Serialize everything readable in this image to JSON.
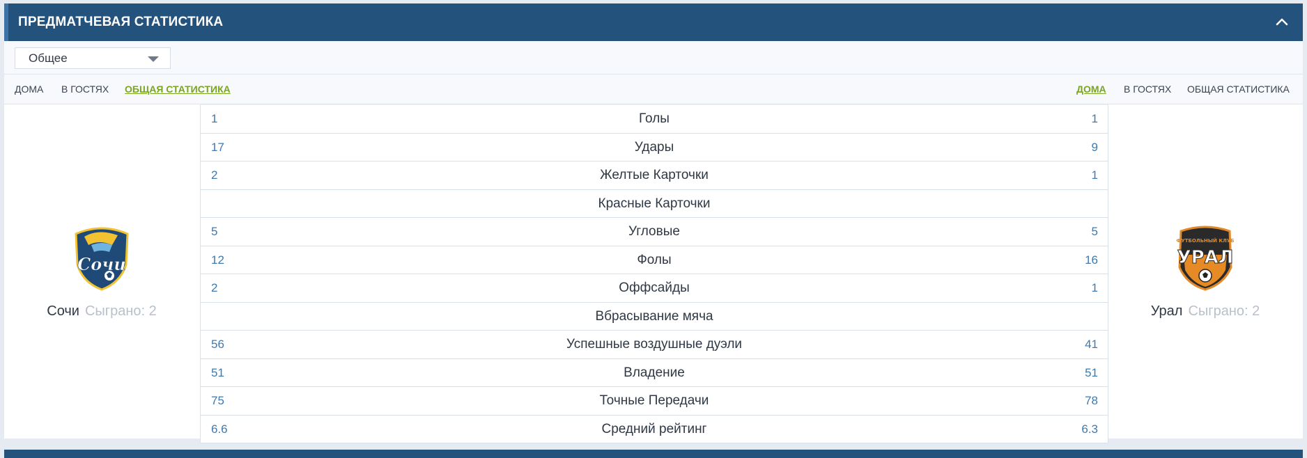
{
  "header": {
    "title": "ПРЕДМАТЧЕВАЯ СТАТИСТИКА",
    "collapse_icon": "chevron-up-icon"
  },
  "filter": {
    "selected": "Общее"
  },
  "tabs_left": [
    {
      "label": "ДОМА",
      "active": false
    },
    {
      "label": "В ГОСТЯХ",
      "active": false
    },
    {
      "label": "ОБЩАЯ СТАТИСТИКА",
      "active": true
    }
  ],
  "tabs_right": [
    {
      "label": "ДОМА",
      "active": true
    },
    {
      "label": "В ГОСТЯХ",
      "active": false
    },
    {
      "label": "ОБЩАЯ СТАТИСТИКА",
      "active": false
    }
  ],
  "team_left": {
    "name": "Сочи",
    "played": "Сыграно: 2",
    "logo_text": "Сочи"
  },
  "team_right": {
    "name": "Урал",
    "played": "Сыграно: 2",
    "logo_text": "УРАЛ",
    "logo_subtext": "ФУТБОЛЬНЫЙ КЛУБ"
  },
  "stats": [
    {
      "left": "1",
      "label": "Голы",
      "right": "1"
    },
    {
      "left": "17",
      "label": "Удары",
      "right": "9"
    },
    {
      "left": "2",
      "label": "Желтые Карточки",
      "right": "1"
    },
    {
      "left": "",
      "label": "Красные Карточки",
      "right": ""
    },
    {
      "left": "5",
      "label": "Угловые",
      "right": "5"
    },
    {
      "left": "12",
      "label": "Фолы",
      "right": "16"
    },
    {
      "left": "2",
      "label": "Оффсайды",
      "right": "1"
    },
    {
      "left": "",
      "label": "Вбрасывание мяча",
      "right": ""
    },
    {
      "left": "56",
      "label": "Успешные воздушные дуэли",
      "right": "41"
    },
    {
      "left": "51",
      "label": "Владение",
      "right": "51"
    },
    {
      "left": "75",
      "label": "Точные Передачи",
      "right": "78"
    },
    {
      "left": "6.6",
      "label": "Средний рейтинг",
      "right": "6.3"
    }
  ],
  "colors": {
    "header_bg": "#23527d",
    "active_tab": "#7aa51f",
    "stat_value": "#3f79ad",
    "muted": "#b9c0c9"
  }
}
